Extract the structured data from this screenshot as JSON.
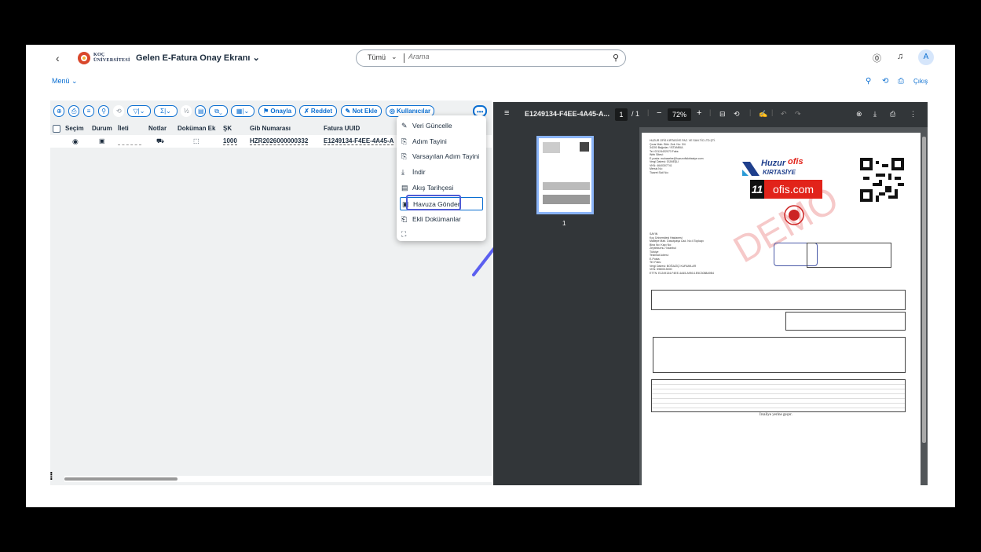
{
  "shell": {
    "title": "Gelen E-Fatura Onay Ekranı",
    "title_arrow": "⌄",
    "logo_line1": "KOÇ",
    "logo_line2": "ÜNİVERSİTESİ",
    "search": {
      "scope": "Tümü",
      "placeholder": "Arama"
    },
    "avatar": "A"
  },
  "subbar": {
    "menu": "Menü ⌄",
    "logout": "Çıkış"
  },
  "toolbar": {
    "approve": "Onayla",
    "reject": "Reddet",
    "add_note": "Not Ekle",
    "users": "Kullanıcılar",
    "more": "•••"
  },
  "grid": {
    "columns": [
      "Seçim",
      "Durum",
      "İleti",
      "Notlar",
      "Doküman Ek",
      "ŞK",
      "Gib Numarası",
      "Fatura UUID"
    ],
    "row": {
      "sk": "1000",
      "gib": "HZR2026000000332",
      "uuid": "E1249134-F4EE-4A45-A"
    }
  },
  "dropdown": {
    "items": [
      {
        "icon": "pencil-icon",
        "label": "Veri Güncelle"
      },
      {
        "icon": "step-icon",
        "label": "Adım Tayini"
      },
      {
        "icon": "default-step-icon",
        "label": "Varsayılan Adım Tayini"
      },
      {
        "icon": "download-icon",
        "label": "İndir"
      },
      {
        "icon": "history-icon",
        "label": "Akış Tarihçesi"
      },
      {
        "icon": "pool-icon",
        "label": "Havuza Gönder"
      },
      {
        "icon": "attachment-icon",
        "label": "Ekli Dokümanlar"
      }
    ]
  },
  "pdf": {
    "filename": "E1249134-F4EE-4A45-A...",
    "page_current": "1",
    "page_total": "/ 1",
    "zoom": "72%",
    "thumb_page": "1",
    "invoice": {
      "brand1": "Huzur",
      "brand2": "ofis",
      "brand3": "KIRTASİYE",
      "brand_ofis": "ofis.com",
      "brand_11": "11",
      "watermark": "DEMO",
      "footer_note": "İrsaliye yerine geçer."
    }
  }
}
